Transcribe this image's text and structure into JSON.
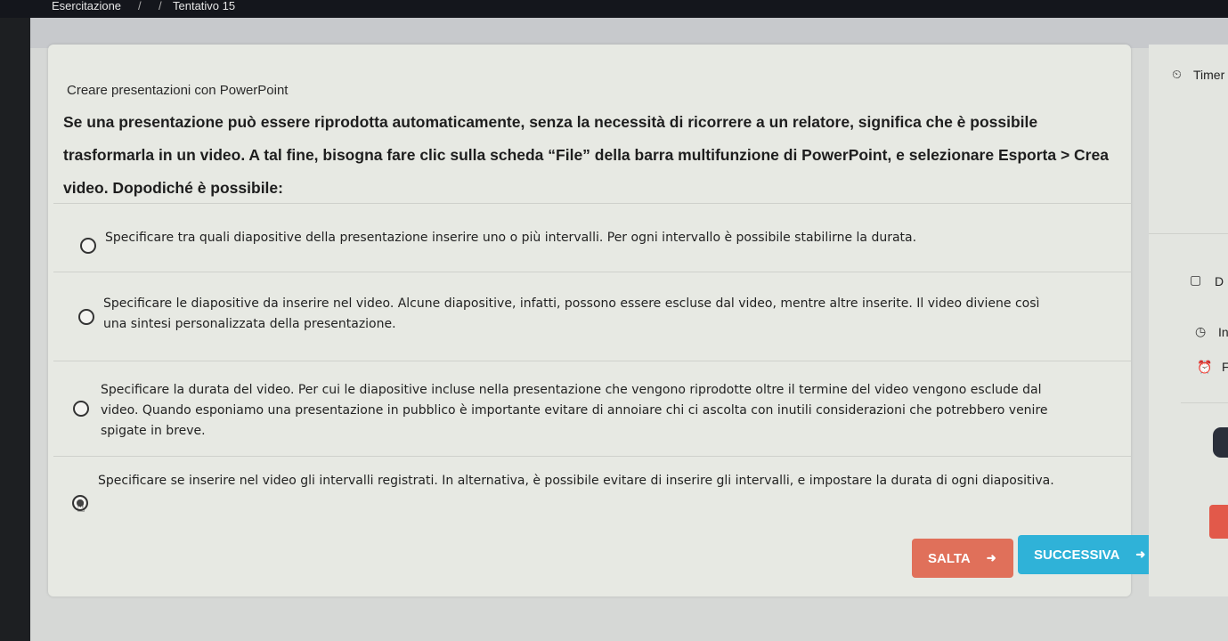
{
  "breadcrumb": {
    "item1": "Esercitazione",
    "sep1": "/",
    "sep2": "/",
    "item2": "Tentativo 15"
  },
  "card": {
    "subject": "Creare presentazioni con PowerPoint",
    "question": "Se una presentazione può essere riprodotta automaticamente, senza la necessità di ricorrere a un relatore, significa che è possibile trasformarla in un video. A tal fine, bisogna fare clic sulla scheda “File” della barra multifunzione di PowerPoint, e selezionare Esporta > Crea video. Dopodiché è possibile:",
    "options": [
      {
        "text": "Specificare tra quali diapositive della presentazione inserire uno o più intervalli. Per ogni intervallo è possibile stabilirne la durata.",
        "selected": false
      },
      {
        "text": "Specificare le diapositive da inserire nel video. Alcune diapositive, infatti, possono essere escluse dal video, mentre altre inserite. Il video diviene così una sintesi personalizzata della presentazione.",
        "selected": false
      },
      {
        "text": "Specificare la durata del video. Per cui le diapositive incluse nella presentazione che vengono riprodotte oltre il termine del video vengono esclude dal video. Quando esponiamo una presentazione in pubblico è importante evitare di annoiare chi ci ascolta con inutili considerazioni che potrebbero venire spigate in breve.",
        "selected": false
      },
      {
        "text": "Specificare se inserire nel video gli intervalli registrati. In alternativa, è possibile evitare di inserire gli intervalli, e impostare la durata di ogni diapositiva.",
        "selected": true
      }
    ],
    "buttons": {
      "skip": "SALTA",
      "next": "SUCCESSIVA"
    }
  },
  "sidebar": {
    "timer": "Timer",
    "item_d": "D",
    "item_i": "In",
    "item_f": "F"
  },
  "colors": {
    "skip": "#e0705a",
    "next": "#2fb2d8",
    "card": "#e7e9e3"
  },
  "icons": [
    "timer-icon",
    "document-icon",
    "clock-icon",
    "alarm-icon",
    "arrow-right-icon",
    "cursor-hand-icon"
  ]
}
